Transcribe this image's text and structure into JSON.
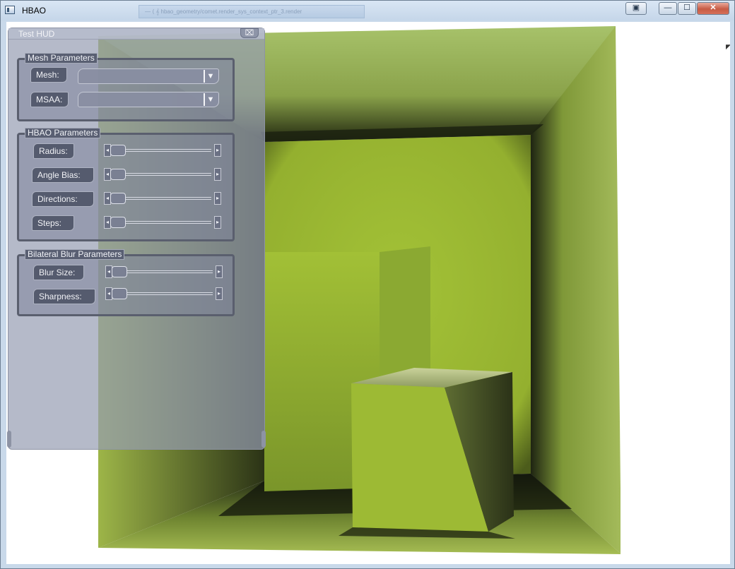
{
  "window": {
    "title": "HBAO",
    "background_tab_text": "— ⟨ 𝄞 hbao_geometry/comet.render_sys_context_ptr_3.render",
    "buttons": {
      "extra": "▣",
      "minimize": "—",
      "maximize": "☐",
      "close": "✕"
    }
  },
  "hud": {
    "title": "Test HUD",
    "close_glyph": "⌧",
    "mesh_group": {
      "title": "Mesh Parameters",
      "mesh_label": "Mesh:",
      "msaa_label": "MSAA:",
      "mesh_value": "",
      "msaa_value": ""
    },
    "hbao_group": {
      "title": "HBAO Parameters",
      "sliders": [
        {
          "label": "Radius:",
          "value": 0
        },
        {
          "label": "Angle Bias:",
          "value": 0
        },
        {
          "label": "Directions:",
          "value": 0
        },
        {
          "label": "Steps:",
          "value": 0
        }
      ]
    },
    "blur_group": {
      "title": "Bilateral Blur Parameters",
      "sliders": [
        {
          "label": "Blur Size:",
          "value": 0
        },
        {
          "label": "Sharpness:",
          "value": 0
        }
      ]
    }
  },
  "colors": {
    "scene_green": "#a6c23a",
    "scene_dark": "#1d2212",
    "hud_panel": "#969cb2"
  }
}
